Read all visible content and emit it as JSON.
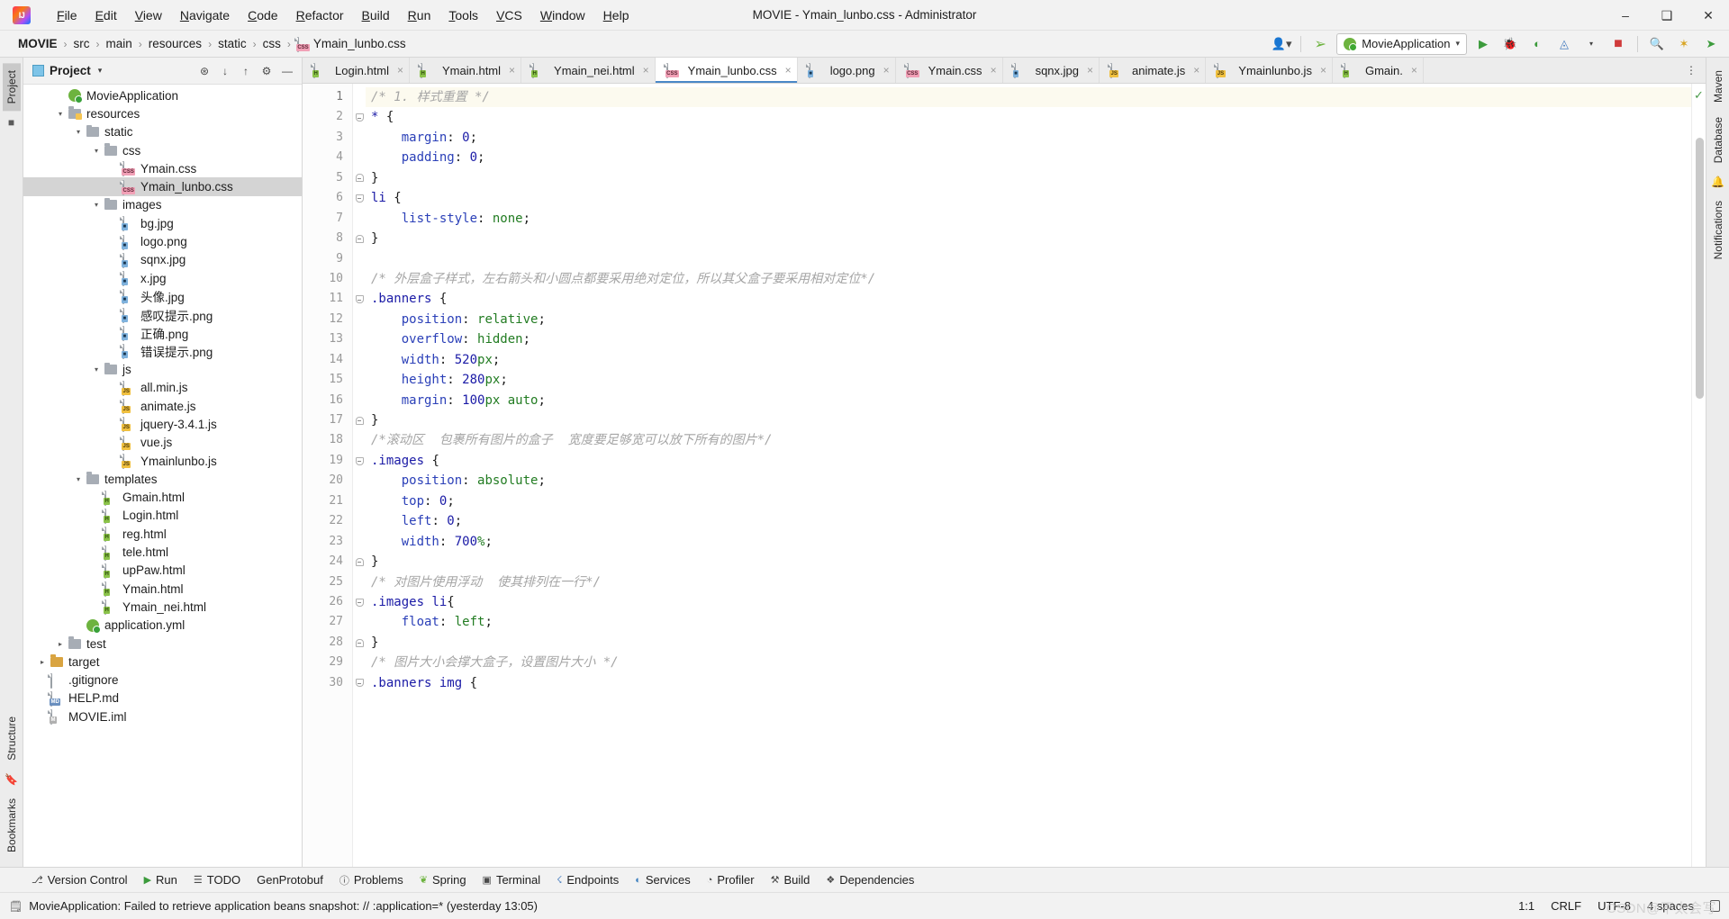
{
  "titlebar": {
    "window_title": "MOVIE - Ymain_lunbo.css - Administrator",
    "logo_icon": "intellij-idea-logo-icon",
    "menus": [
      {
        "label": "File"
      },
      {
        "label": "Edit"
      },
      {
        "label": "View"
      },
      {
        "label": "Navigate"
      },
      {
        "label": "Code"
      },
      {
        "label": "Refactor"
      },
      {
        "label": "Build"
      },
      {
        "label": "Run"
      },
      {
        "label": "Tools"
      },
      {
        "label": "VCS"
      },
      {
        "label": "Window"
      },
      {
        "label": "Help"
      }
    ],
    "window_buttons": [
      {
        "name": "minimize-button",
        "glyph": "–"
      },
      {
        "name": "maximize-button",
        "glyph": "❐"
      },
      {
        "name": "close-button",
        "glyph": "✕"
      }
    ]
  },
  "navbar": {
    "breadcrumbs": [
      {
        "label": "MOVIE",
        "icon": "project-root"
      },
      {
        "label": "src",
        "icon": ""
      },
      {
        "label": "main",
        "icon": ""
      },
      {
        "label": "resources",
        "icon": ""
      },
      {
        "label": "static",
        "icon": ""
      },
      {
        "label": "css",
        "icon": ""
      },
      {
        "label": "Ymain_lunbo.css",
        "icon": "css-file-icon"
      }
    ],
    "separator": "›",
    "run_config": "MovieApplication",
    "right_icons": [
      {
        "name": "user-account-icon",
        "glyph": "👤"
      },
      {
        "name": "updates-hammer-icon",
        "glyph": "⚒"
      },
      {
        "name": "run-button",
        "glyph": "▶"
      },
      {
        "name": "debug-button",
        "glyph": "🐞"
      },
      {
        "name": "run-with-coverage-button",
        "glyph": "◷"
      },
      {
        "name": "profile-button",
        "glyph": "◴"
      },
      {
        "name": "stop-button",
        "glyph": "■"
      },
      {
        "name": "search-everywhere-icon",
        "glyph": "🔍"
      },
      {
        "name": "settings-gear-icon",
        "glyph": "⚙"
      },
      {
        "name": "ide-assistant-icon",
        "glyph": "➤"
      }
    ]
  },
  "left_strip": {
    "tabs": [
      {
        "label": "Project",
        "active": true
      }
    ],
    "bottom_tabs": [
      {
        "label": "Bookmarks"
      },
      {
        "label": "Structure"
      }
    ],
    "icons": [
      {
        "name": "commit-icon"
      },
      {
        "name": "bookmark-icon"
      }
    ]
  },
  "right_strip": {
    "tabs": [
      {
        "label": "Maven"
      },
      {
        "label": "Database"
      },
      {
        "label": "Notifications"
      }
    ]
  },
  "project_panel": {
    "title": "Project",
    "caret": "▼",
    "tools": [
      {
        "name": "select-opened-file-icon",
        "glyph": "⊕"
      },
      {
        "name": "expand-all-icon",
        "glyph": "⤓"
      },
      {
        "name": "collapse-all-icon",
        "glyph": "⤑"
      },
      {
        "name": "settings-gear-icon",
        "glyph": "⚙"
      },
      {
        "name": "hide-panel-icon",
        "glyph": "—"
      }
    ],
    "tree": [
      {
        "label": "MovieApplication",
        "indent": 3,
        "icon": "spring-app",
        "arrow": "",
        "selected": false
      },
      {
        "label": "resources",
        "indent": 3,
        "icon": "folder-resources",
        "arrow": "∨",
        "selected": false
      },
      {
        "label": "static",
        "indent": 4,
        "icon": "folder",
        "arrow": "∨",
        "selected": false
      },
      {
        "label": "css",
        "indent": 5,
        "icon": "folder",
        "arrow": "∨",
        "selected": false
      },
      {
        "label": "Ymain.css",
        "indent": 6,
        "icon": "css-file",
        "arrow": "",
        "selected": false
      },
      {
        "label": "Ymain_lunbo.css",
        "indent": 6,
        "icon": "css-file",
        "arrow": "",
        "selected": true
      },
      {
        "label": "images",
        "indent": 5,
        "icon": "folder",
        "arrow": "∨",
        "selected": false
      },
      {
        "label": "bg.jpg",
        "indent": 6,
        "icon": "image-file",
        "arrow": "",
        "selected": false
      },
      {
        "label": "logo.png",
        "indent": 6,
        "icon": "image-file",
        "arrow": "",
        "selected": false
      },
      {
        "label": "sqnx.jpg",
        "indent": 6,
        "icon": "image-file",
        "arrow": "",
        "selected": false
      },
      {
        "label": "x.jpg",
        "indent": 6,
        "icon": "image-file",
        "arrow": "",
        "selected": false
      },
      {
        "label": "头像.jpg",
        "indent": 6,
        "icon": "image-file",
        "arrow": "",
        "selected": false
      },
      {
        "label": "感叹提示.png",
        "indent": 6,
        "icon": "image-file",
        "arrow": "",
        "selected": false
      },
      {
        "label": "正确.png",
        "indent": 6,
        "icon": "image-file",
        "arrow": "",
        "selected": false
      },
      {
        "label": "错误提示.png",
        "indent": 6,
        "icon": "image-file",
        "arrow": "",
        "selected": false
      },
      {
        "label": "js",
        "indent": 5,
        "icon": "folder",
        "arrow": "∨",
        "selected": false
      },
      {
        "label": "all.min.js",
        "indent": 6,
        "icon": "js-min-file",
        "arrow": "",
        "selected": false
      },
      {
        "label": "animate.js",
        "indent": 6,
        "icon": "js-file",
        "arrow": "",
        "selected": false
      },
      {
        "label": "jquery-3.4.1.js",
        "indent": 6,
        "icon": "js-file",
        "arrow": "",
        "selected": false
      },
      {
        "label": "vue.js",
        "indent": 6,
        "icon": "js-file",
        "arrow": "",
        "selected": false
      },
      {
        "label": "Ymainlunbo.js",
        "indent": 6,
        "icon": "js-file",
        "arrow": "",
        "selected": false
      },
      {
        "label": "templates",
        "indent": 4,
        "icon": "folder",
        "arrow": "∨",
        "selected": false
      },
      {
        "label": "Gmain.html",
        "indent": 5,
        "icon": "html-file",
        "arrow": "",
        "selected": false
      },
      {
        "label": "Login.html",
        "indent": 5,
        "icon": "html-file",
        "arrow": "",
        "selected": false
      },
      {
        "label": "reg.html",
        "indent": 5,
        "icon": "html-file",
        "arrow": "",
        "selected": false
      },
      {
        "label": "tele.html",
        "indent": 5,
        "icon": "html-file",
        "arrow": "",
        "selected": false
      },
      {
        "label": "upPaw.html",
        "indent": 5,
        "icon": "html-file",
        "arrow": "",
        "selected": false
      },
      {
        "label": "Ymain.html",
        "indent": 5,
        "icon": "html-file",
        "arrow": "",
        "selected": false
      },
      {
        "label": "Ymain_nei.html",
        "indent": 5,
        "icon": "html-file",
        "arrow": "",
        "selected": false
      },
      {
        "label": "application.yml",
        "indent": 4,
        "icon": "yml-file",
        "arrow": "",
        "selected": false
      },
      {
        "label": "test",
        "indent": 3,
        "icon": "folder",
        "arrow": "›",
        "selected": false
      },
      {
        "label": "target",
        "indent": 2,
        "icon": "folder-target",
        "arrow": "›",
        "selected": false
      },
      {
        "label": ".gitignore",
        "indent": 2,
        "icon": "plain-file",
        "arrow": "",
        "selected": false
      },
      {
        "label": "HELP.md",
        "indent": 2,
        "icon": "md-file",
        "arrow": "",
        "selected": false
      },
      {
        "label": "MOVIE.iml",
        "indent": 2,
        "icon": "iml-file",
        "arrow": "",
        "selected": false
      }
    ]
  },
  "editor": {
    "tabs": [
      {
        "label": "Login.html",
        "type": "html",
        "active": false
      },
      {
        "label": "Ymain.html",
        "type": "html",
        "active": false
      },
      {
        "label": "Ymain_nei.html",
        "type": "html",
        "active": false
      },
      {
        "label": "Ymain_lunbo.css",
        "type": "css",
        "active": true
      },
      {
        "label": "logo.png",
        "type": "image",
        "active": false
      },
      {
        "label": "Ymain.css",
        "type": "css",
        "active": false
      },
      {
        "label": "sqnx.jpg",
        "type": "image",
        "active": false
      },
      {
        "label": "animate.js",
        "type": "js",
        "active": false
      },
      {
        "label": "Ymainlunbo.js",
        "type": "js",
        "active": false
      },
      {
        "label": "Gmain.",
        "type": "html",
        "active": false
      }
    ],
    "tab_overflow_icon": "more-tabs-icon",
    "inspection_status_icon": "no-errors-checkmark",
    "lines": [
      {
        "n": 1,
        "fold": "",
        "cur": true,
        "tokens": [
          {
            "t": "/* 1. 样式重置 */",
            "c": "k-comment"
          }
        ]
      },
      {
        "n": 2,
        "fold": "open",
        "cur": false,
        "tokens": [
          {
            "t": "* ",
            "c": "k-sel"
          },
          {
            "t": "{",
            "c": "k-punc"
          }
        ]
      },
      {
        "n": 3,
        "fold": "",
        "cur": false,
        "tokens": [
          {
            "t": "    margin",
            "c": "k-prop"
          },
          {
            "t": ": ",
            "c": "k-punc"
          },
          {
            "t": "0",
            "c": "k-num"
          },
          {
            "t": ";",
            "c": "k-punc"
          }
        ]
      },
      {
        "n": 4,
        "fold": "",
        "cur": false,
        "tokens": [
          {
            "t": "    padding",
            "c": "k-prop"
          },
          {
            "t": ": ",
            "c": "k-punc"
          },
          {
            "t": "0",
            "c": "k-num"
          },
          {
            "t": ";",
            "c": "k-punc"
          }
        ]
      },
      {
        "n": 5,
        "fold": "close",
        "cur": false,
        "tokens": [
          {
            "t": "}",
            "c": "k-punc"
          }
        ]
      },
      {
        "n": 6,
        "fold": "open",
        "cur": false,
        "tokens": [
          {
            "t": "li ",
            "c": "k-sel"
          },
          {
            "t": "{",
            "c": "k-punc"
          }
        ]
      },
      {
        "n": 7,
        "fold": "",
        "cur": false,
        "tokens": [
          {
            "t": "    list-style",
            "c": "k-prop"
          },
          {
            "t": ": ",
            "c": "k-punc"
          },
          {
            "t": "none",
            "c": "k-val"
          },
          {
            "t": ";",
            "c": "k-punc"
          }
        ]
      },
      {
        "n": 8,
        "fold": "close",
        "cur": false,
        "tokens": [
          {
            "t": "}",
            "c": "k-punc"
          }
        ]
      },
      {
        "n": 9,
        "fold": "",
        "cur": false,
        "tokens": []
      },
      {
        "n": 10,
        "fold": "",
        "cur": false,
        "tokens": [
          {
            "t": "/* 外层盒子样式，左右箭头和小圆点都要采用绝对定位，所以其父盒子要采用相对定位*/",
            "c": "k-comment"
          }
        ]
      },
      {
        "n": 11,
        "fold": "open",
        "cur": false,
        "tokens": [
          {
            "t": ".banners ",
            "c": "k-sel"
          },
          {
            "t": "{",
            "c": "k-punc"
          }
        ]
      },
      {
        "n": 12,
        "fold": "",
        "cur": false,
        "tokens": [
          {
            "t": "    position",
            "c": "k-prop"
          },
          {
            "t": ": ",
            "c": "k-punc"
          },
          {
            "t": "relative",
            "c": "k-val"
          },
          {
            "t": ";",
            "c": "k-punc"
          }
        ]
      },
      {
        "n": 13,
        "fold": "",
        "cur": false,
        "tokens": [
          {
            "t": "    overflow",
            "c": "k-prop"
          },
          {
            "t": ": ",
            "c": "k-punc"
          },
          {
            "t": "hidden",
            "c": "k-val"
          },
          {
            "t": ";",
            "c": "k-punc"
          }
        ]
      },
      {
        "n": 14,
        "fold": "",
        "cur": false,
        "tokens": [
          {
            "t": "    width",
            "c": "k-prop"
          },
          {
            "t": ": ",
            "c": "k-punc"
          },
          {
            "t": "520",
            "c": "k-num"
          },
          {
            "t": "px",
            "c": "k-unit"
          },
          {
            "t": ";",
            "c": "k-punc"
          }
        ]
      },
      {
        "n": 15,
        "fold": "",
        "cur": false,
        "tokens": [
          {
            "t": "    height",
            "c": "k-prop"
          },
          {
            "t": ": ",
            "c": "k-punc"
          },
          {
            "t": "280",
            "c": "k-num"
          },
          {
            "t": "px",
            "c": "k-unit"
          },
          {
            "t": ";",
            "c": "k-punc"
          }
        ]
      },
      {
        "n": 16,
        "fold": "",
        "cur": false,
        "tokens": [
          {
            "t": "    margin",
            "c": "k-prop"
          },
          {
            "t": ": ",
            "c": "k-punc"
          },
          {
            "t": "100",
            "c": "k-num"
          },
          {
            "t": "px ",
            "c": "k-unit"
          },
          {
            "t": "auto",
            "c": "k-val"
          },
          {
            "t": ";",
            "c": "k-punc"
          }
        ]
      },
      {
        "n": 17,
        "fold": "close",
        "cur": false,
        "tokens": [
          {
            "t": "}",
            "c": "k-punc"
          }
        ]
      },
      {
        "n": 18,
        "fold": "",
        "cur": false,
        "tokens": [
          {
            "t": "/*滚动区  包裹所有图片的盒子  宽度要足够宽可以放下所有的图片*/",
            "c": "k-comment"
          }
        ]
      },
      {
        "n": 19,
        "fold": "open",
        "cur": false,
        "tokens": [
          {
            "t": ".images ",
            "c": "k-sel"
          },
          {
            "t": "{",
            "c": "k-punc"
          }
        ]
      },
      {
        "n": 20,
        "fold": "",
        "cur": false,
        "tokens": [
          {
            "t": "    position",
            "c": "k-prop"
          },
          {
            "t": ": ",
            "c": "k-punc"
          },
          {
            "t": "absolute",
            "c": "k-val"
          },
          {
            "t": ";",
            "c": "k-punc"
          }
        ]
      },
      {
        "n": 21,
        "fold": "",
        "cur": false,
        "tokens": [
          {
            "t": "    top",
            "c": "k-prop"
          },
          {
            "t": ": ",
            "c": "k-punc"
          },
          {
            "t": "0",
            "c": "k-num"
          },
          {
            "t": ";",
            "c": "k-punc"
          }
        ]
      },
      {
        "n": 22,
        "fold": "",
        "cur": false,
        "tokens": [
          {
            "t": "    left",
            "c": "k-prop"
          },
          {
            "t": ": ",
            "c": "k-punc"
          },
          {
            "t": "0",
            "c": "k-num"
          },
          {
            "t": ";",
            "c": "k-punc"
          }
        ]
      },
      {
        "n": 23,
        "fold": "",
        "cur": false,
        "tokens": [
          {
            "t": "    width",
            "c": "k-prop"
          },
          {
            "t": ": ",
            "c": "k-punc"
          },
          {
            "t": "700",
            "c": "k-num"
          },
          {
            "t": "%",
            "c": "k-unit"
          },
          {
            "t": ";",
            "c": "k-punc"
          }
        ]
      },
      {
        "n": 24,
        "fold": "close",
        "cur": false,
        "tokens": [
          {
            "t": "}",
            "c": "k-punc"
          }
        ]
      },
      {
        "n": 25,
        "fold": "",
        "cur": false,
        "tokens": [
          {
            "t": "/* 对图片使用浮动  使其排列在一行*/",
            "c": "k-comment"
          }
        ]
      },
      {
        "n": 26,
        "fold": "open",
        "cur": false,
        "tokens": [
          {
            "t": ".images li",
            "c": "k-sel"
          },
          {
            "t": "{",
            "c": "k-punc"
          }
        ]
      },
      {
        "n": 27,
        "fold": "",
        "cur": false,
        "tokens": [
          {
            "t": "    float",
            "c": "k-prop"
          },
          {
            "t": ": ",
            "c": "k-punc"
          },
          {
            "t": "left",
            "c": "k-val"
          },
          {
            "t": ";",
            "c": "k-punc"
          }
        ]
      },
      {
        "n": 28,
        "fold": "close",
        "cur": false,
        "tokens": [
          {
            "t": "}",
            "c": "k-punc"
          }
        ]
      },
      {
        "n": 29,
        "fold": "",
        "cur": false,
        "tokens": [
          {
            "t": "/* 图片大小会撑大盒子，设置图片大小 */",
            "c": "k-comment"
          }
        ]
      },
      {
        "n": 30,
        "fold": "open",
        "cur": false,
        "tokens": [
          {
            "t": ".banners img ",
            "c": "k-sel"
          },
          {
            "t": "{",
            "c": "k-punc"
          }
        ]
      }
    ]
  },
  "bottom_toolbar": [
    {
      "label": "Version Control",
      "icon": "branch-icon"
    },
    {
      "label": "Run",
      "icon": "run-play-icon"
    },
    {
      "label": "TODO",
      "icon": "todo-list-icon"
    },
    {
      "label": "GenProtobuf",
      "icon": ""
    },
    {
      "label": "Problems",
      "icon": "problems-warning-icon"
    },
    {
      "label": "Spring",
      "icon": "spring-leaf-icon"
    },
    {
      "label": "Terminal",
      "icon": "terminal-icon"
    },
    {
      "label": "Endpoints",
      "icon": "endpoints-icon"
    },
    {
      "label": "Services",
      "icon": "services-icon"
    },
    {
      "label": "Profiler",
      "icon": "profiler-icon"
    },
    {
      "label": "Build",
      "icon": "build-hammer-icon"
    },
    {
      "label": "Dependencies",
      "icon": "dependencies-icon"
    }
  ],
  "statusbar": {
    "message": "MovieApplication: Failed to retrieve application beans snapshot: // :application=* (yesterday 13:05)",
    "message_icon": "event-log-icon",
    "caret_position": "1:1",
    "line_separator": "CRLF",
    "encoding": "UTF-8",
    "indent": "4 spaces",
    "lock_icon": "read-only-lock-icon",
    "watermark": "CSDN@不太会写"
  }
}
